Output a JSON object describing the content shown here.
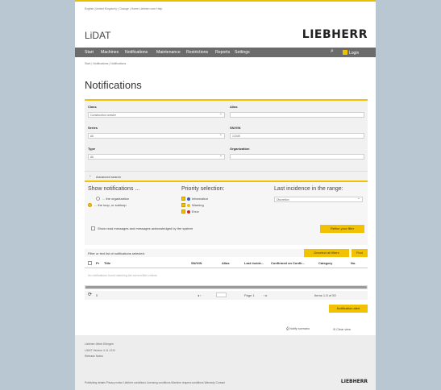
{
  "header": {
    "top_links": "English (United Kingdom) | Change   |   Home   Liebherr.com   Help",
    "app_name": "LiDAT",
    "brand": "LIEBHERR"
  },
  "nav": {
    "items": [
      "Start",
      "Machines",
      "Notifications",
      "Maintenance",
      "Restrictions",
      "Reports",
      "Settings"
    ],
    "search_icon": "search-icon",
    "login_label": "Login"
  },
  "breadcrumb": "Start  |  Notifications  |  Notifications",
  "page_title": "Notifications",
  "filters": {
    "class_label": "Class",
    "class_value": "Construction crawler",
    "alias_label": "Alias",
    "alias_value": "",
    "series_label": "Series",
    "series_value": "All",
    "snvin_label": "SN/VIN",
    "snvin_value": "12345",
    "type_label": "Type",
    "type_value": "All",
    "org_label": "Organization",
    "org_value": "",
    "advanced_label": "Advanced search"
  },
  "options": {
    "show_heading": "Show notifications ...",
    "show_options": [
      "... the organization",
      "... the loop, or subloop"
    ],
    "priority_heading": "Priority selection:",
    "priority_options": [
      {
        "label": "Information",
        "color": "#2f5fb3"
      },
      {
        "label": "Warning",
        "color": "#f2c200"
      },
      {
        "label": "Error",
        "color": "#d42a1f"
      }
    ],
    "range_heading": "Last incidence in the range:",
    "range_value": "Discretion",
    "read_label": "Show read messages and messages acknowledged by the system",
    "search_button": "Refine your filter"
  },
  "list": {
    "status_text": "Filter or text list of notifications selected.",
    "deselect_button": "Deselect all filters",
    "find_button": "Find",
    "columns": [
      "Pr",
      "Title",
      "SN/VIN",
      "Alias",
      "Last incide...",
      "Confirmed on",
      "Confir...",
      "Category",
      "No."
    ],
    "empty_text": "No notifications found matching the current filter criteria",
    "pager_left": "0",
    "pager_mid": "Page 1",
    "pager_right": "Items 1-5 of 50"
  },
  "actions": {
    "notif_export": "Notification alert",
    "info_link": "Notify scenario",
    "clear_link": "Clear view"
  },
  "footer": {
    "lines": [
      "Liebherr-Werk Ehingen",
      "LiDAT Version 4.11.13 B",
      "Release Notes"
    ],
    "bottom_links": "Publishing details    Privacy notice    Liebherr conditions    Licensing conditions    Machine request conditions    Warranty    Contact",
    "brand": "LIEBHERR"
  }
}
